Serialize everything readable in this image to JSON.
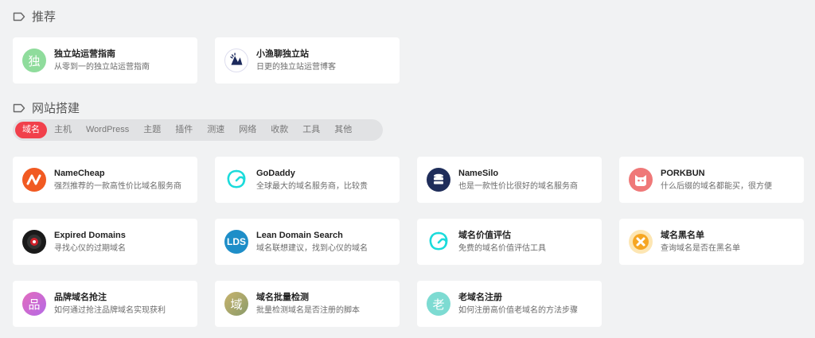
{
  "sections": {
    "recommend": {
      "title": "推荐"
    },
    "site_build": {
      "title": "网站搭建"
    }
  },
  "tabs": [
    "域名",
    "主机",
    "WordPress",
    "主题",
    "插件",
    "测速",
    "网络",
    "收款",
    "工具",
    "其他"
  ],
  "active_tab": "域名",
  "colors": {
    "accent": "#f1404b",
    "background": "#f1f2f3"
  },
  "recommend_cards": [
    {
      "name": "独立站运营指南",
      "desc": "从零到一的独立站运营指南",
      "icon": "du-char-logo",
      "glyph": "独"
    },
    {
      "name": "小渔聊独立站",
      "desc": "日更的独立站运营博客",
      "icon": "xiaoyu-logo"
    }
  ],
  "domain_cards": [
    {
      "name": "NameCheap",
      "desc": "强烈推荐的一款高性价比域名服务商",
      "icon": "namecheap-logo"
    },
    {
      "name": "GoDaddy",
      "desc": "全球最大的域名服务商，比较贵",
      "icon": "godaddy-logo"
    },
    {
      "name": "NameSilo",
      "desc": "也是一款性价比很好的域名服务商",
      "icon": "namesilo-logo"
    },
    {
      "name": "PORKBUN",
      "desc": "什么后缀的域名都能买，很方便",
      "icon": "porkbun-logo"
    },
    {
      "name": "Expired Domains",
      "desc": "寻找心仪的过期域名",
      "icon": "expired-domains-logo"
    },
    {
      "name": "Lean Domain Search",
      "desc": "域名联想建议，找到心仪的域名",
      "icon": "lean-domain-search-logo",
      "glyph": "LDS"
    },
    {
      "name": "域名价值评估",
      "desc": "免费的域名价值评估工具",
      "icon": "domain-value-logo"
    },
    {
      "name": "域名黑名单",
      "desc": "查询域名是否在黑名单",
      "icon": "domain-blacklist-logo"
    },
    {
      "name": "品牌域名抢注",
      "desc": "如何通过抢注品牌域名实现获利",
      "icon": "brand-domain-logo",
      "glyph": "品"
    },
    {
      "name": "域名批量检测",
      "desc": "批量检测域名是否注册的脚本",
      "icon": "batch-check-logo",
      "glyph": "域"
    },
    {
      "name": "老域名注册",
      "desc": "如何注册高价值老域名的方法步骤",
      "icon": "old-domain-logo",
      "glyph": "老"
    }
  ]
}
